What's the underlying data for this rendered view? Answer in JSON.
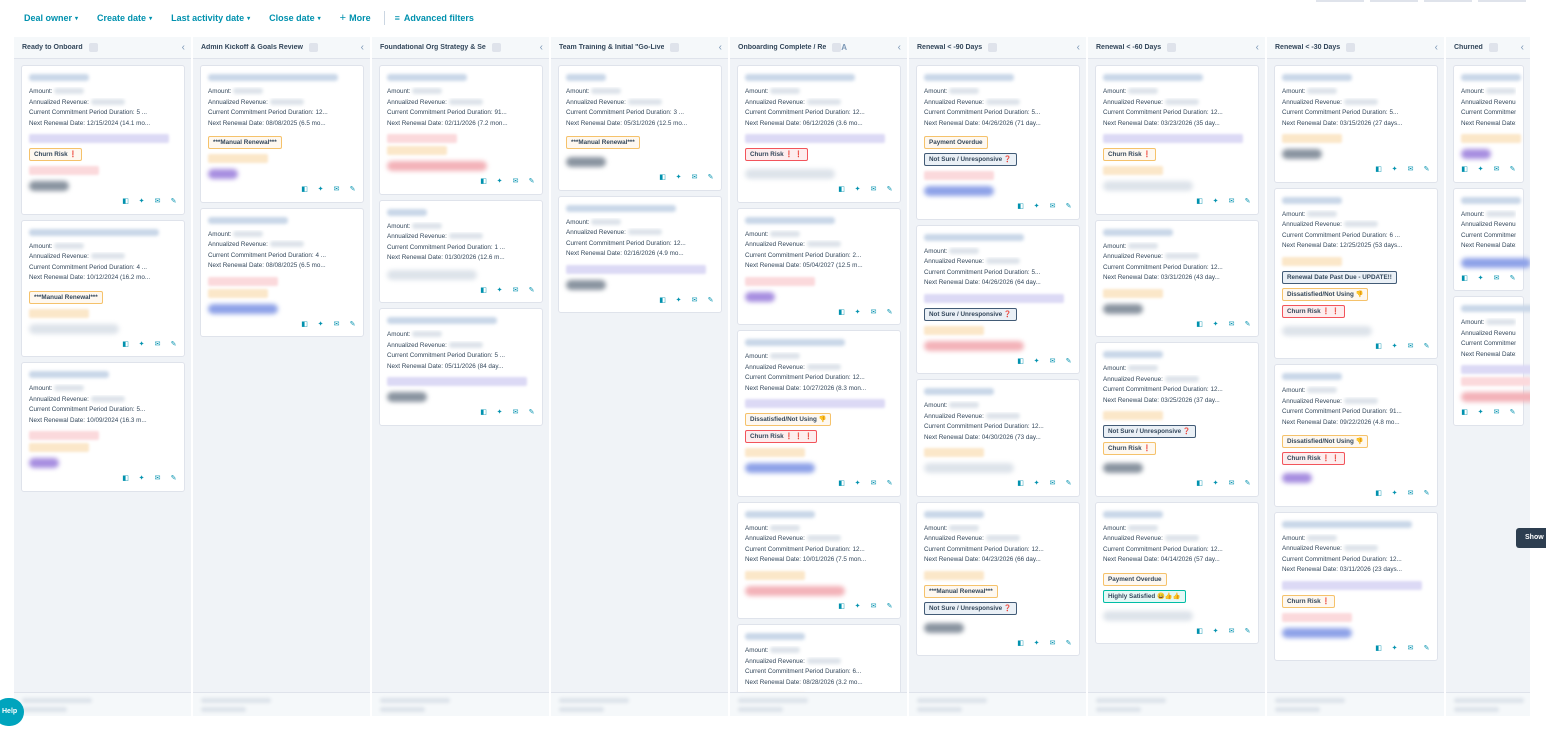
{
  "filters": {
    "deal_owner": "Deal owner",
    "create_date": "Create date",
    "last_activity": "Last activity date",
    "close_date": "Close date",
    "more": "More",
    "advanced": "Advanced filters",
    "caret": "▾",
    "plus": "+",
    "lines_icon": "≡"
  },
  "icons": {
    "collapse": "‹",
    "sort": "A",
    "card_actions": [
      "◧",
      "✦",
      "✉",
      "✎"
    ]
  },
  "labels": {
    "amount": "Amount:",
    "arr": "Annualized Revenue:",
    "duration": "Current Commitment Period Duration:",
    "renewal": "Next Renewal Date:"
  },
  "columns": [
    {
      "title": "Ready to Onboard",
      "cards": [
        {
          "duration": "5 ...",
          "renewal": "12/15/2024 (14.1 mo...",
          "tags": [
            {
              "text": "Churn Risk ❗",
              "style": "orange"
            }
          ]
        },
        {
          "duration": "4 ...",
          "renewal": "10/12/2024 (16.2 mo...",
          "tags": [
            {
              "text": "***Manual Renewal***",
              "style": "orange"
            }
          ]
        },
        {
          "duration": "5...",
          "renewal": "10/09/2024 (16.3 m...",
          "tags": []
        }
      ]
    },
    {
      "title": "Admin Kickoff & Goals Review",
      "cards": [
        {
          "duration": "12...",
          "renewal": "08/08/2025 (6.5 mo...",
          "tags": [
            {
              "text": "***Manual Renewal***",
              "style": "orange"
            }
          ]
        },
        {
          "duration": "4 ...",
          "renewal": "08/08/2025 (6.5 mo...",
          "tags": []
        }
      ]
    },
    {
      "title": "Foundational Org Strategy & Se",
      "cards": [
        {
          "duration": "91...",
          "renewal": "02/11/2026 (7.2 mon...",
          "tags": []
        },
        {
          "duration": "1 ...",
          "renewal": "01/30/2026 (12.6 m...",
          "tags": []
        },
        {
          "duration": "5 ...",
          "renewal": "05/11/2026 (84 day...",
          "tags": []
        }
      ]
    },
    {
      "title": "Team Training & Initial \"Go-Live",
      "cards": [
        {
          "duration": "3 ...",
          "renewal": "05/31/2026 (12.5 mo...",
          "tags": [
            {
              "text": "***Manual Renewal***",
              "style": "orange"
            }
          ]
        },
        {
          "duration": "12...",
          "renewal": "02/16/2026 (4.9 mo...",
          "tags": []
        }
      ]
    },
    {
      "title": "Onboarding Complete / Re",
      "cards": [
        {
          "duration": "12...",
          "renewal": "06/12/2026 (3.6 mo...",
          "tags": [
            {
              "text": "Churn Risk ❗ ❗",
              "style": "red"
            }
          ]
        },
        {
          "duration": "2...",
          "renewal": "05/04/2027 (12.5 m...",
          "tags": []
        },
        {
          "duration": "12...",
          "renewal": "10/27/2026 (8.3 mon...",
          "tags": [
            {
              "text": "Dissatisfied/Not Using 👎",
              "style": "orange"
            },
            {
              "text": "Churn Risk ❗ ❗ ❗",
              "style": "red"
            }
          ]
        },
        {
          "duration": "12...",
          "renewal": "10/01/2026 (7.5 mon...",
          "tags": []
        },
        {
          "duration": "6...",
          "renewal": "08/28/2026 (3.2 mo...",
          "tags": []
        }
      ]
    },
    {
      "title": "Renewal < -90 Days",
      "cards": [
        {
          "duration": "5...",
          "renewal": "04/26/2026 (71 day...",
          "tags": [
            {
              "text": "Payment Overdue",
              "style": "orange"
            },
            {
              "text": "Not Sure / Unresponsive ❓",
              "style": "blue"
            }
          ]
        },
        {
          "duration": "5...",
          "renewal": "04/26/2026 (64 day...",
          "tags": [
            {
              "text": "Not Sure / Unresponsive ❓",
              "style": "blue"
            }
          ]
        },
        {
          "duration": "12...",
          "renewal": "04/30/2026 (73 day...",
          "tags": []
        },
        {
          "duration": "12...",
          "renewal": "04/23/2026 (66 day...",
          "tags": [
            {
              "text": "***Manual Renewal***",
              "style": "orange"
            },
            {
              "text": "Not Sure / Unresponsive ❓",
              "style": "blue"
            }
          ]
        }
      ]
    },
    {
      "title": "Renewal < -60 Days",
      "cards": [
        {
          "duration": "12...",
          "renewal": "03/23/2026 (35 day...",
          "tags": [
            {
              "text": "Churn Risk ❗",
              "style": "orange"
            }
          ]
        },
        {
          "duration": "12...",
          "renewal": "03/31/2026 (43 day...",
          "tags": []
        },
        {
          "duration": "12...",
          "renewal": "03/25/2026 (37 day...",
          "tags": [
            {
              "text": "Not Sure / Unresponsive ❓",
              "style": "blue"
            },
            {
              "text": "Churn Risk ❗",
              "style": "orange"
            }
          ]
        },
        {
          "duration": "12...",
          "renewal": "04/14/2026 (57 day...",
          "tags": [
            {
              "text": "Payment Overdue",
              "style": "orange"
            },
            {
              "text": "Highly Satisfied 😀👍👍",
              "style": "green"
            }
          ]
        }
      ]
    },
    {
      "title": "Renewal < -30 Days",
      "cards": [
        {
          "duration": "5...",
          "renewal": "03/15/2026 (27 days...",
          "tags": []
        },
        {
          "duration": "6 ...",
          "renewal": "12/25/2025 (53 days...",
          "tags": [
            {
              "text": "Renewal Date Past Due - UPDATE!!",
              "style": "blue"
            },
            {
              "text": "Dissatisfied/Not Using 👎",
              "style": "orange"
            },
            {
              "text": "Churn Risk ❗ ❗",
              "style": "red"
            }
          ]
        },
        {
          "duration": "91...",
          "renewal": "09/22/2026 (4.8 mo...",
          "tags": [
            {
              "text": "Dissatisfied/Not Using 👎",
              "style": "orange"
            },
            {
              "text": "Churn Risk ❗ ❗",
              "style": "red"
            }
          ]
        },
        {
          "duration": "12...",
          "renewal": "03/11/2026 (23 days...",
          "tags": [
            {
              "text": "Churn Risk ❗",
              "style": "orange"
            }
          ]
        }
      ]
    },
    {
      "title": "Churned",
      "cards": [
        {
          "duration": "",
          "renewal": "",
          "tags": []
        },
        {
          "duration": "",
          "renewal": "",
          "tags": []
        },
        {
          "duration": "",
          "renewal": "",
          "tags": []
        }
      ]
    }
  ],
  "show_button": "Show",
  "help_button": "Help"
}
